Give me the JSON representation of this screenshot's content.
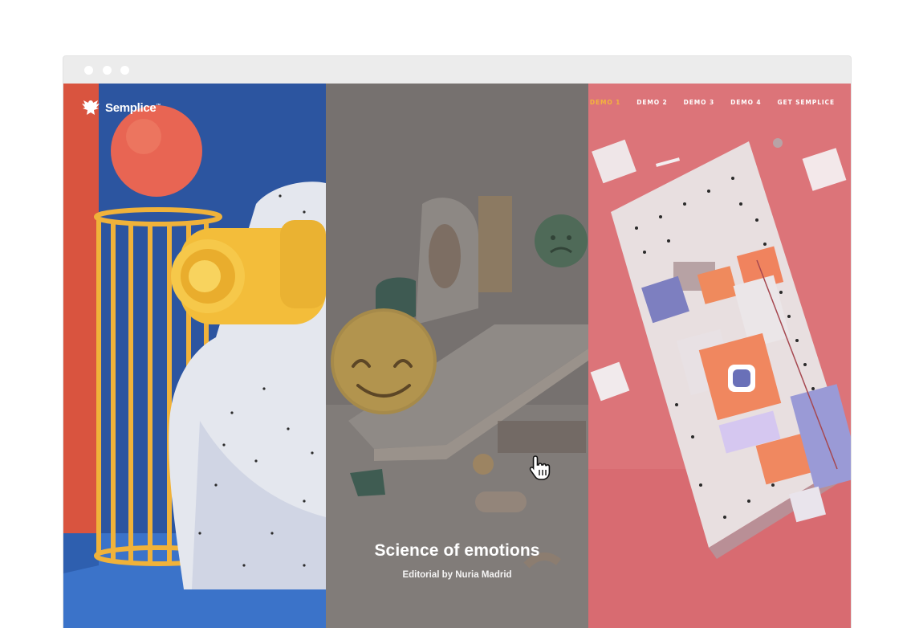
{
  "browser": {
    "window_controls": [
      "dot",
      "dot",
      "dot"
    ]
  },
  "site": {
    "logo": {
      "text": "Semplice",
      "mark": "™",
      "icon": "eagle-logo-icon"
    },
    "nav": [
      {
        "label": "DEMO 1",
        "active": true
      },
      {
        "label": "DEMO 2",
        "active": false
      },
      {
        "label": "DEMO 3",
        "active": false
      },
      {
        "label": "DEMO 4",
        "active": false
      },
      {
        "label": "GET SEMPLICE",
        "active": false
      }
    ],
    "accent_color": "#f3b43c"
  },
  "panels": [
    {
      "name": "hand-binoculars-artwork",
      "background": "#2f5aa6"
    },
    {
      "name": "emotions-artwork",
      "background": "#767171",
      "title": "Science of emotions",
      "subtitle": "Editorial by Nuria Madrid",
      "hovered": true
    },
    {
      "name": "pegboard-artwork",
      "background": "#dc7479"
    }
  ],
  "cursor": "hand-pointer-icon"
}
